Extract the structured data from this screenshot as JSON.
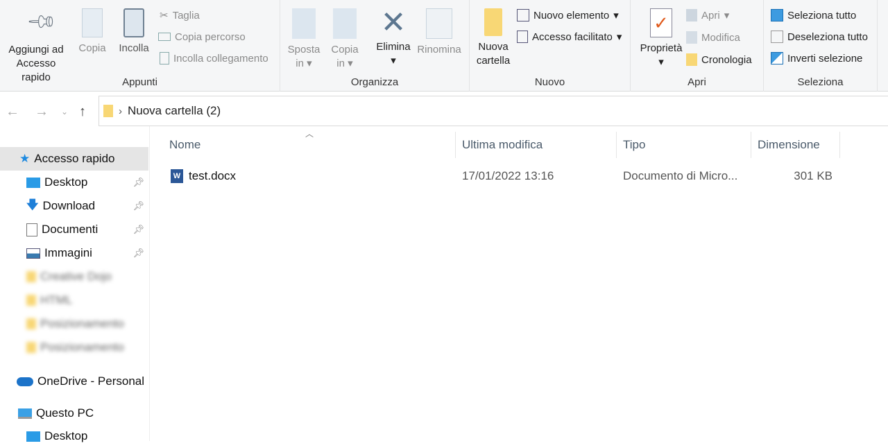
{
  "ribbon": {
    "appunti": {
      "label": "Appunti",
      "pin": "Aggiungi ad\nAccesso rapido",
      "pin1": "Aggiungi ad",
      "pin2": "Accesso rapido",
      "copy": "Copia",
      "paste": "Incolla",
      "cut": "Taglia",
      "copy_path": "Copia percorso",
      "paste_link": "Incolla collegamento"
    },
    "organizza": {
      "label": "Organizza",
      "move1": "Sposta",
      "move2": "in",
      "copyto1": "Copia",
      "copyto2": "in",
      "delete": "Elimina",
      "rename": "Rinomina"
    },
    "nuovo": {
      "label": "Nuovo",
      "new_folder1": "Nuova",
      "new_folder2": "cartella",
      "new_item": "Nuovo elemento",
      "easy_access": "Accesso facilitato"
    },
    "apri": {
      "label": "Apri",
      "properties": "Proprietà",
      "open": "Apri",
      "edit": "Modifica",
      "history": "Cronologia"
    },
    "seleziona": {
      "label": "Seleziona",
      "select_all": "Seleziona tutto",
      "select_none": "Deseleziona tutto",
      "invert": "Inverti selezione"
    }
  },
  "address": {
    "path": "Nuova cartella (2)"
  },
  "sidebar": {
    "quick_access": "Accesso rapido",
    "items": [
      "Desktop",
      "Download",
      "Documenti",
      "Immagini"
    ],
    "blurred": [
      "Creative Dojo",
      "HTML",
      "Posizionamento",
      "Posizionamento"
    ],
    "onedrive": "OneDrive - Personal",
    "this_pc": "Questo PC",
    "pc_desktop": "Desktop"
  },
  "columns": {
    "name": "Nome",
    "modified": "Ultima modifica",
    "type": "Tipo",
    "size": "Dimensione"
  },
  "files": [
    {
      "name": "test.docx",
      "modified": "17/01/2022 13:16",
      "type": "Documento di Micro...",
      "size": "301 KB",
      "icon": "word-document-icon"
    }
  ],
  "colors": {
    "accent": "#0078d7",
    "folder": "#f8d775",
    "selected": "#e5e5e5"
  }
}
